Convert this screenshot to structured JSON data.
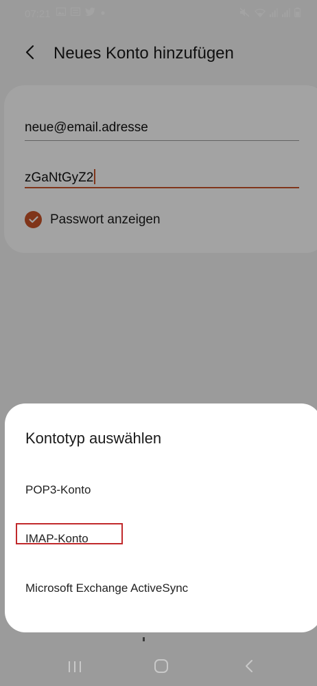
{
  "status_bar": {
    "time": "07:21",
    "left_icons": [
      "gallery-icon",
      "message-icon",
      "twitter-icon",
      "dot-icon"
    ],
    "right_icons": [
      "mute-icon",
      "wifi-icon",
      "signal-icon",
      "signal-icon",
      "battery-icon"
    ]
  },
  "header": {
    "title": "Neues Konto hinzufügen",
    "back_icon": "chevron-left-icon"
  },
  "form": {
    "email_value": "neue@email.adresse",
    "password_value": "zGaNtGyZ2",
    "show_password_label": "Passwort anzeigen",
    "show_password_checked": true
  },
  "sheet": {
    "title": "Kontotyp auswählen",
    "options": [
      "POP3-Konto",
      "IMAP-Konto",
      "Microsoft Exchange ActiveSync"
    ]
  },
  "nav_bar": {
    "icons": [
      "recent-apps-icon",
      "home-icon",
      "back-icon"
    ]
  },
  "colors": {
    "accent": "#c8542a",
    "highlight": "#c0282a",
    "overlay": "rgba(0,0,0,0.36)"
  }
}
